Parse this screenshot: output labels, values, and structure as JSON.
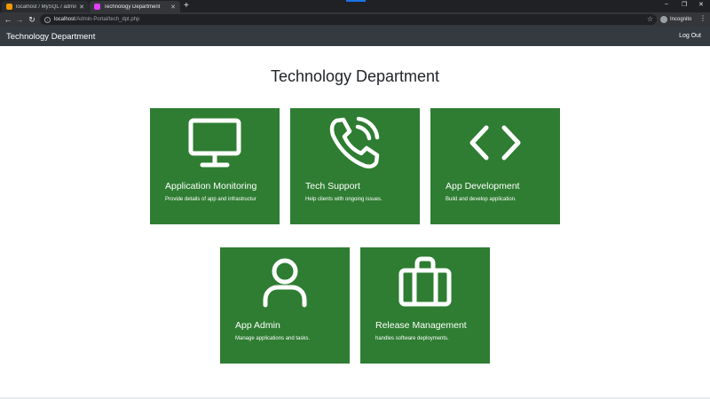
{
  "browser": {
    "tabs": [
      {
        "title": "localhost / MySQL / admin / users",
        "active": false,
        "favicon_color": "#f29900"
      },
      {
        "title": "Technology Department",
        "active": true,
        "favicon_color": "#e040fb"
      }
    ],
    "url_host": "localhost",
    "url_path": "/Admin-Portal/tech_dpt.php",
    "profile_label": "Incognito"
  },
  "navbar": {
    "brand": "Technology Department",
    "logout_label": "Log Out"
  },
  "page": {
    "title": "Technology Department"
  },
  "cards": [
    {
      "title": "Application Monitoring",
      "description": "Provide details of app and infrastructur",
      "icon": "monitor-icon"
    },
    {
      "title": "Tech Support",
      "description": "Help clients with ongoing issues.",
      "icon": "phone-icon"
    },
    {
      "title": "App Development",
      "description": "Build and develop application.",
      "icon": "code-icon"
    },
    {
      "title": "App Admin",
      "description": "Manage applications and tasks.",
      "icon": "user-icon"
    },
    {
      "title": "Release Management",
      "description": "handles software deployments.",
      "icon": "briefcase-icon"
    }
  ],
  "colors": {
    "card_green": "#2e7d32",
    "navbar_dark": "#343a40"
  }
}
